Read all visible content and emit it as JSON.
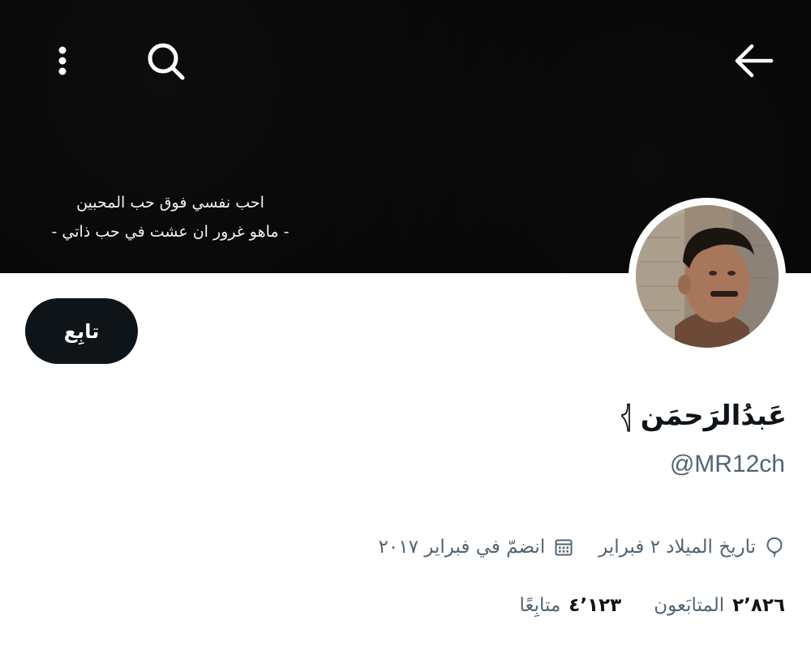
{
  "header": {
    "back_icon": "arrow-left-icon",
    "search_icon": "search-icon",
    "more_icon": "more-vertical-icon"
  },
  "banner": {
    "quote_line1": "احب نفسي فوق حب المحبين",
    "quote_line2": "- ماهو غرور ان عشت في حب ذاتي -"
  },
  "profile": {
    "follow_label": "تابِع",
    "display_name": "عَبدُالرَحمَن 𓂆",
    "handle": "@MR12ch",
    "birthday": "تاريخ الميلاد ٢ فبراير",
    "joined": "انضمّ في فبراير ٢٠١٧"
  },
  "stats": {
    "followers_count": "٢٬٨٢٦",
    "followers_label": "المتابَعون",
    "following_count": "٤٬١٢٣",
    "following_label": "متابِعًا"
  },
  "colors": {
    "text_primary": "#0f1419",
    "text_secondary": "#536471",
    "button_bg": "#0f1419",
    "banner_bg": "#050505"
  }
}
